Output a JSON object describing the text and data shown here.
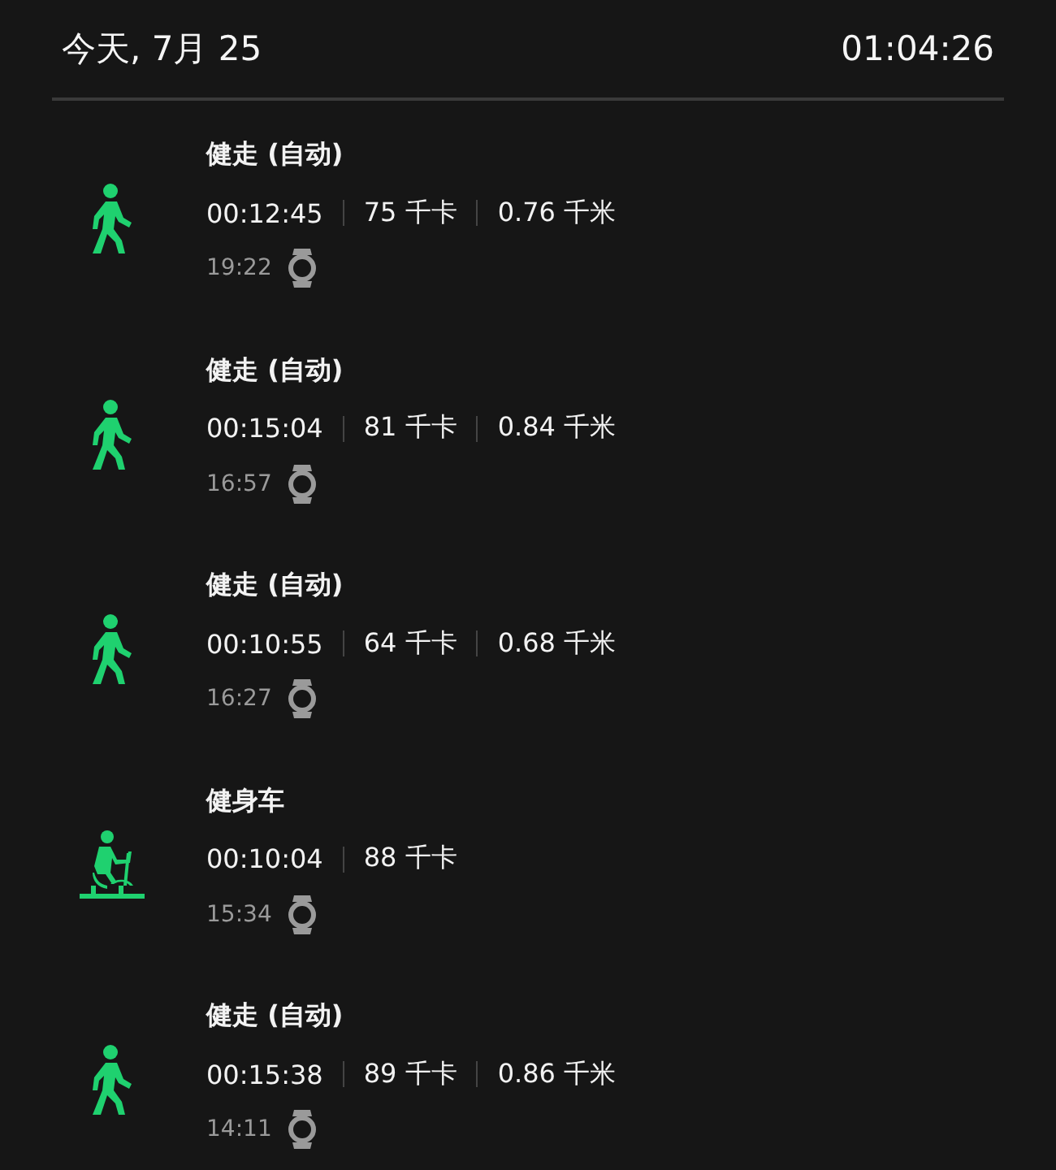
{
  "header": {
    "date": "今天, 7月 25",
    "total": "01:04:26"
  },
  "activities": [
    {
      "kind": "walk",
      "title": "健走 (自动)",
      "stats": [
        "00:12:45",
        "75 千卡",
        "0.76 千米"
      ],
      "time": "19:22"
    },
    {
      "kind": "walk",
      "title": "健走 (自动)",
      "stats": [
        "00:15:04",
        "81 千卡",
        "0.84 千米"
      ],
      "time": "16:57"
    },
    {
      "kind": "walk",
      "title": "健走 (自动)",
      "stats": [
        "00:10:55",
        "64 千卡",
        "0.68 千米"
      ],
      "time": "16:27"
    },
    {
      "kind": "bike",
      "title": "健身车",
      "stats": [
        "00:10:04",
        "88 千卡"
      ],
      "time": "15:34"
    },
    {
      "kind": "walk",
      "title": "健走 (自动)",
      "stats": [
        "00:15:38",
        "89 千卡",
        "0.86 千米"
      ],
      "time": "14:11"
    }
  ]
}
